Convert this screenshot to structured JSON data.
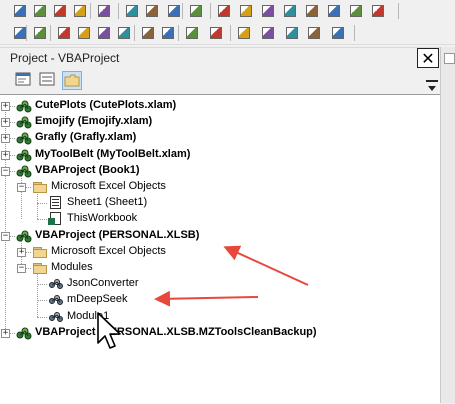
{
  "toolbar_row1": [
    "sheet-grid-icon",
    "rows-icon",
    "split-icon",
    "layout-icon",
    "folder-open-icon",
    "copy-icon",
    "paste-icon",
    "clear-icon",
    "binoculars-icon",
    "find-next-icon",
    "macro-icon",
    "bookmark-icon",
    "table-icon",
    "arrange-icon",
    "stack-icon",
    "move-up-icon",
    "move-down-icon"
  ],
  "toolbar_row2": [
    "edit-icon",
    "format-icon",
    "align-left-icon",
    "align-right-icon",
    "align-center-icon",
    "justify-icon",
    "indent-icon",
    "outdent-icon",
    "insert-icon",
    "list-icon",
    "info-icon",
    "view-icon",
    "object-icon",
    "procedure-icon",
    "sum-icon"
  ],
  "panel": {
    "title": "Project - VBAProject",
    "close_glyph": "✕"
  },
  "view_buttons": [
    "view-code-icon",
    "view-object-icon",
    "toggle-folders-icon"
  ],
  "tree": {
    "nodes": [
      {
        "label": "CutePlots (CutePlots.xlam)",
        "bold": true
      },
      {
        "label": "Emojify (Emojify.xlam)",
        "bold": true
      },
      {
        "label": "Grafly (Grafly.xlam)",
        "bold": true
      },
      {
        "label": "MyToolBelt (MyToolBelt.xlam)",
        "bold": true
      },
      {
        "label": "VBAProject (Book1)",
        "bold": true
      },
      {
        "label": "Microsoft Excel Objects"
      },
      {
        "label": "Sheet1 (Sheet1)"
      },
      {
        "label": "ThisWorkbook"
      },
      {
        "label": "VBAProject (PERSONAL.XLSB)",
        "bold": true
      },
      {
        "label": "Microsoft Excel Objects"
      },
      {
        "label": "Modules"
      },
      {
        "label": "JsonConverter"
      },
      {
        "label": "mDeepSeek"
      },
      {
        "label": "Module1"
      },
      {
        "label": "VBAProject (PERSONAL.XLSB.MZToolsCleanBackup)",
        "bold": true
      }
    ],
    "expand_plus": "+",
    "expand_minus": "−"
  },
  "colors": {
    "annotation_arrow": "#e8473c",
    "selection": "#c9e0f7",
    "folder": "#f1d691"
  }
}
